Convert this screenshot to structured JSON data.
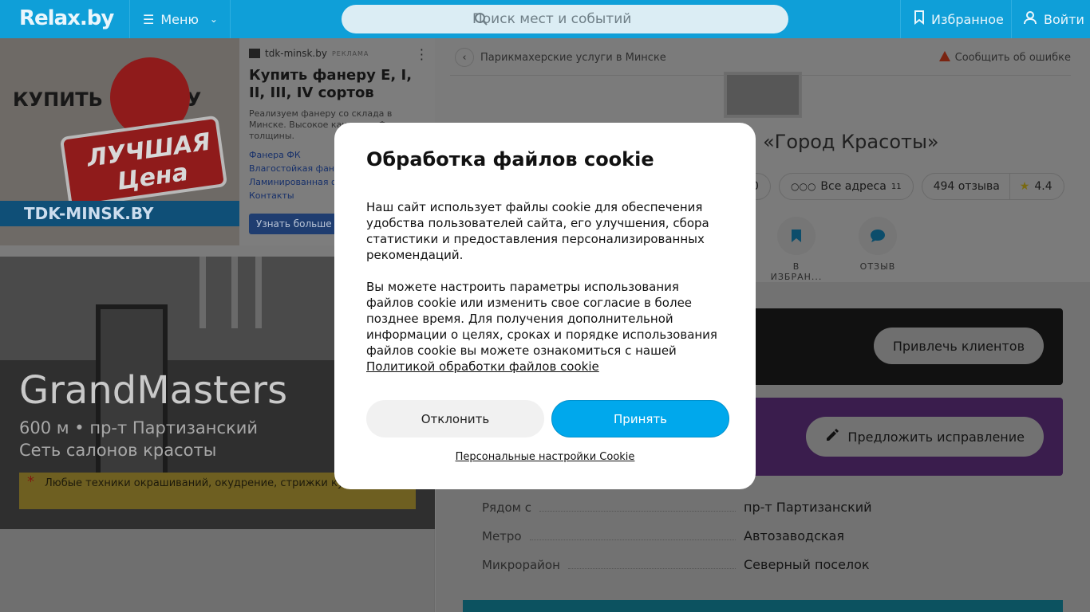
{
  "header": {
    "logo": "Relax.by",
    "menu_label": "Меню",
    "search_placeholder": "Поиск мест и событий",
    "favorites_label": "Избранное",
    "login_label": "Войти"
  },
  "ad": {
    "image_text_buy": "КУПИТЬ ФАНЕРУ",
    "image_text_best": "ЛУЧШАЯ Цена",
    "image_text_brand": "TDK-MINSK.BY",
    "source": "tdk-minsk.by",
    "tag": "РЕКЛАМА",
    "title": "Купить фанеру Е, I, II, III, IV сортов",
    "description": "Реализуем фанеру со склада в Минске. Высокое качество. Ф... и толщины.",
    "links": [
      "Фанера ФК",
      "Влагостойкая фане...",
      "Ламинированная ф...",
      "Контакты"
    ],
    "cta": "Узнать больше"
  },
  "hero": {
    "name": "GrandMasters",
    "line1": "600 м • пр-т Партизанский",
    "line2": "Сеть салонов красоты",
    "promo": "Любые техники окрашиваний, окудрение, стрижки ку... методом"
  },
  "main": {
    "breadcrumb": "Парикмахерские услуги в Минске",
    "report": "Сообщить об ошибке",
    "firm_title": "«Город Красоты»",
    "chips": {
      "hidden_count": "0",
      "all_addresses": "Все адреса",
      "all_addresses_count": "11",
      "reviews": "494 отзыва",
      "rating": "4.4"
    },
    "actions": [
      {
        "label": "В ИЗБРАН..."
      },
      {
        "label": "ОТЗЫВ"
      }
    ],
    "attract_button": "Привлечь клиентов",
    "suggest_button": "Предложить исправление",
    "info": [
      {
        "key": "Рядом с",
        "value": "пр-т Партизанский"
      },
      {
        "key": "Метро",
        "value": "Автозаводская"
      },
      {
        "key": "Микрорайон",
        "value": "Северный поселок"
      }
    ]
  },
  "cookie": {
    "title": "Обработка файлов cookie",
    "text1": "Наш сайт использует файлы cookie для обеспечения удобства пользователей сайта, его улучшения, сбора статистики и предоставления персонализированных рекомендаций.",
    "text2": "Вы можете настроить параметры использования файлов cookie или изменить свое согласие в более позднее время. Для получения дополнительной информации о целях, сроках и порядке использования файлов cookie вы можете ознакомиться с нашей",
    "policy_link": "Политикой обработки файлов cookie",
    "decline": "Отклонить",
    "accept": "Принять",
    "personal": "Персональные настройки Cookie"
  }
}
